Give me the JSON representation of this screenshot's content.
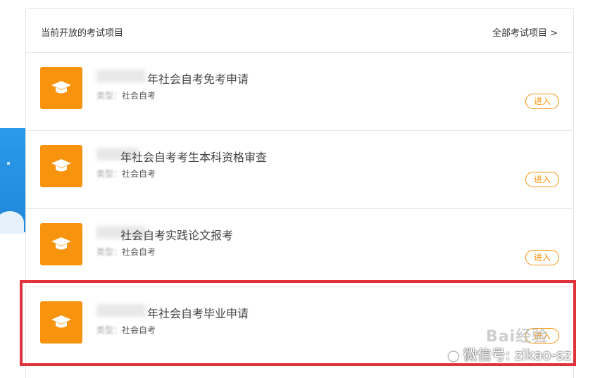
{
  "header": {
    "title": "当前开放的考试项目",
    "all_link": "全部考试项目 >"
  },
  "items": [
    {
      "title": "年社会自考免考申请",
      "type_label": "类型：",
      "type_value": "社会自考",
      "button": "进入"
    },
    {
      "title": "年社会自考考生本科资格审查",
      "type_label": "类型：",
      "type_value": "社会自考",
      "button": "进入"
    },
    {
      "title": "社会自考实践论文报考",
      "type_label": "类型：",
      "type_value": "社会自考",
      "button": "进入"
    },
    {
      "title": "年社会自考毕业申请",
      "type_label": "类型：",
      "type_value": "社会自考",
      "button": "进入"
    }
  ],
  "watermarks": {
    "baidu": "Bai经验",
    "wechat": "微信号: zikao-sz"
  },
  "colors": {
    "accent": "#f7930d",
    "highlight": "#e0323b"
  },
  "icons": {
    "item_icon": "graduation-cap-icon"
  }
}
